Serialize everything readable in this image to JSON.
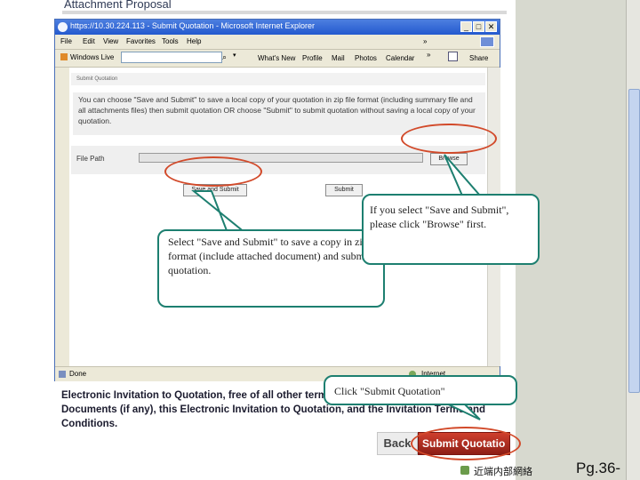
{
  "page": {
    "top_title": "Attachment Proposal",
    "bottom_text": "Electronic Invitation to Quotation, free of all other terms and conditions, the Quotation Documents (if any), this Electronic Invitation to Quotation, and the Invitation Terms and Conditions.",
    "back_label": "Back",
    "submit_quotation_label": "Submit Quotatio",
    "taskbar_text": "近端内部網絡",
    "page_number": "Pg.36-"
  },
  "window": {
    "title": "https://10.30.224.113 - Submit Quotation - Microsoft Internet Explorer",
    "min_glyph": "_",
    "max_glyph": "□",
    "close_glyph": "✕",
    "menu": [
      "File",
      "Edit",
      "View",
      "Favorites",
      "Tools",
      "Help"
    ],
    "menu_more": "»",
    "toolbar": {
      "live_label": "Windows Live",
      "search_placeholder": "",
      "search_glyph": "⌕",
      "dropdown_glyph": "▾",
      "items": [
        "What's New",
        "Profile",
        "Mail",
        "Photos",
        "Calendar"
      ],
      "more_glyph": "»",
      "share_label": "Share"
    },
    "status": {
      "left": "Done",
      "zone": "Internet"
    }
  },
  "form": {
    "section_header": "Submit Quotation",
    "instructions": "You can choose \"Save and Submit\" to save a local copy of your quotation in zip file format (including summary file and all attachments files) then submit quotation OR choose \"Submit\" to submit quotation without saving a local copy of your quotation.",
    "file_path_label": "File Path",
    "browse_label": "Browse",
    "save_and_submit_label": "Save and Submit",
    "submit_label": "Submit"
  },
  "callouts": {
    "browse": "If you select \"Save and Submit\", please click \"Browse\" first.",
    "save_submit": "Select \"Save and Submit\" to save a copy in zip format (include attached document) and submit quotation.",
    "click_submit": "Click \"Submit Quotation\""
  },
  "colors": {
    "ring": "#d24a2a",
    "callout_border": "#1d7f70",
    "ie_titlebar": "#2359cf",
    "submit_button": "#b2301f"
  }
}
